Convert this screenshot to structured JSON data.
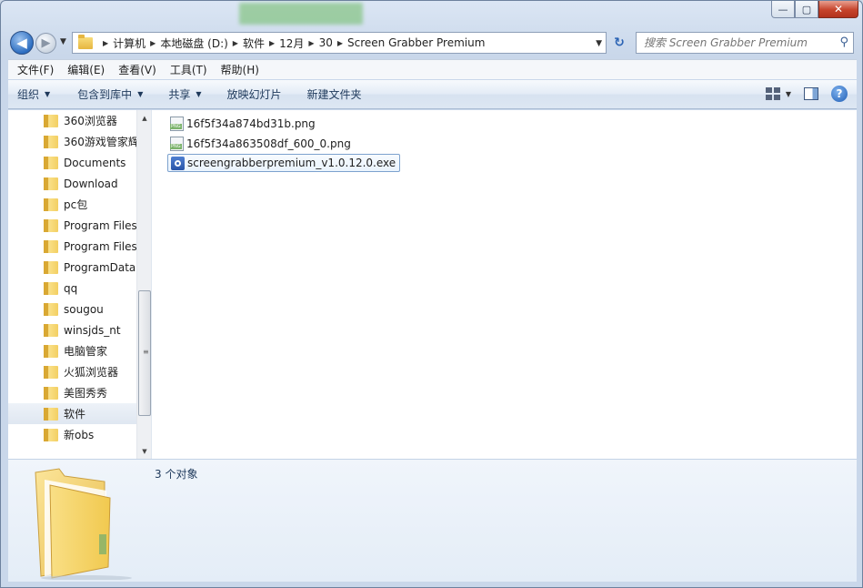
{
  "window": {
    "caption": {
      "min": "—",
      "max": "▢",
      "close": "✕"
    }
  },
  "nav": {
    "back_glyph": "◀",
    "forward_glyph": "▶",
    "history_glyph": "▼",
    "refresh_glyph": "↻",
    "breadcrumbs": [
      "计算机",
      "本地磁盘 (D:)",
      "软件",
      "12月",
      "30",
      "Screen Grabber Premium"
    ],
    "search_placeholder": "搜索 Screen Grabber Premium"
  },
  "menu": [
    "文件(F)",
    "编辑(E)",
    "查看(V)",
    "工具(T)",
    "帮助(H)"
  ],
  "toolbar": {
    "organize": "组织",
    "include_library": "包含到库中",
    "share": "共享",
    "slideshow": "放映幻灯片",
    "new_folder": "新建文件夹",
    "help_glyph": "?"
  },
  "tree": [
    {
      "label": "360浏览器"
    },
    {
      "label": "360游戏管家辉"
    },
    {
      "label": "Documents"
    },
    {
      "label": "Download"
    },
    {
      "label": "pc包"
    },
    {
      "label": "Program Files"
    },
    {
      "label": "Program Files"
    },
    {
      "label": "ProgramData"
    },
    {
      "label": "qq"
    },
    {
      "label": "sougou"
    },
    {
      "label": "winsjds_nt"
    },
    {
      "label": "电脑管家"
    },
    {
      "label": "火狐浏览器"
    },
    {
      "label": "美图秀秀"
    },
    {
      "label": "软件",
      "selected": true
    },
    {
      "label": "新obs"
    }
  ],
  "files": [
    {
      "name": "16f5f34a874bd31b.png",
      "type": "png"
    },
    {
      "name": "16f5f34a863508df_600_0.png",
      "type": "png"
    },
    {
      "name": "screengrabberpremium_v1.0.12.0.exe",
      "type": "exe",
      "selected": true
    }
  ],
  "status": {
    "count_text": "3 个对象"
  },
  "colors": {
    "accent": "#2c6dc0",
    "folder": "#f3cf62",
    "selection": "#7da2ce"
  }
}
